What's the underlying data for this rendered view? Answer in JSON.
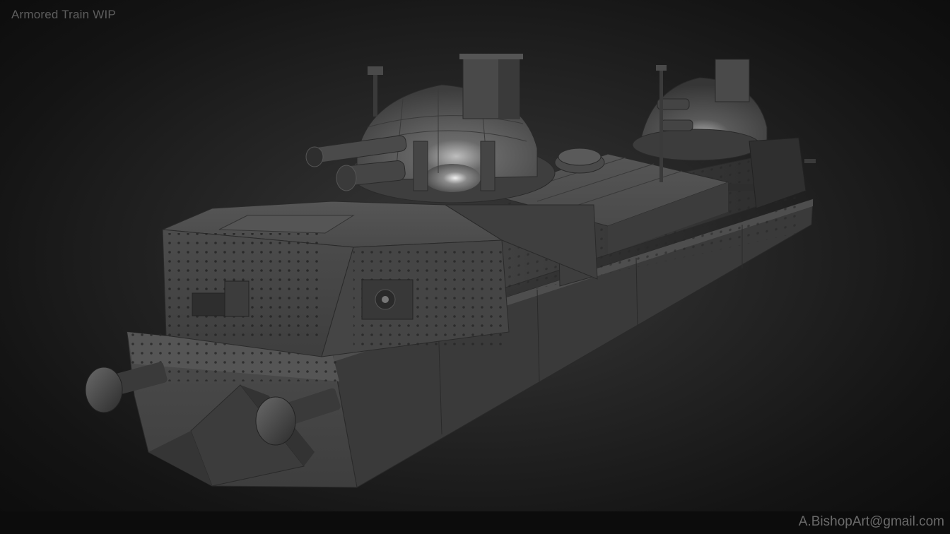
{
  "header": {
    "title": "Armored Train WIP"
  },
  "footer": {
    "credit": "A.BishopArt@gmail.com"
  },
  "scene": {
    "subject": "armored-train-3d-model",
    "palette": {
      "background": "#1a1a1a",
      "armor": "#4a4a4a",
      "armor_light": "#5c5c5c",
      "armor_dark": "#333333",
      "rivet": "#222222",
      "highlight": "#d8d8d8"
    }
  }
}
